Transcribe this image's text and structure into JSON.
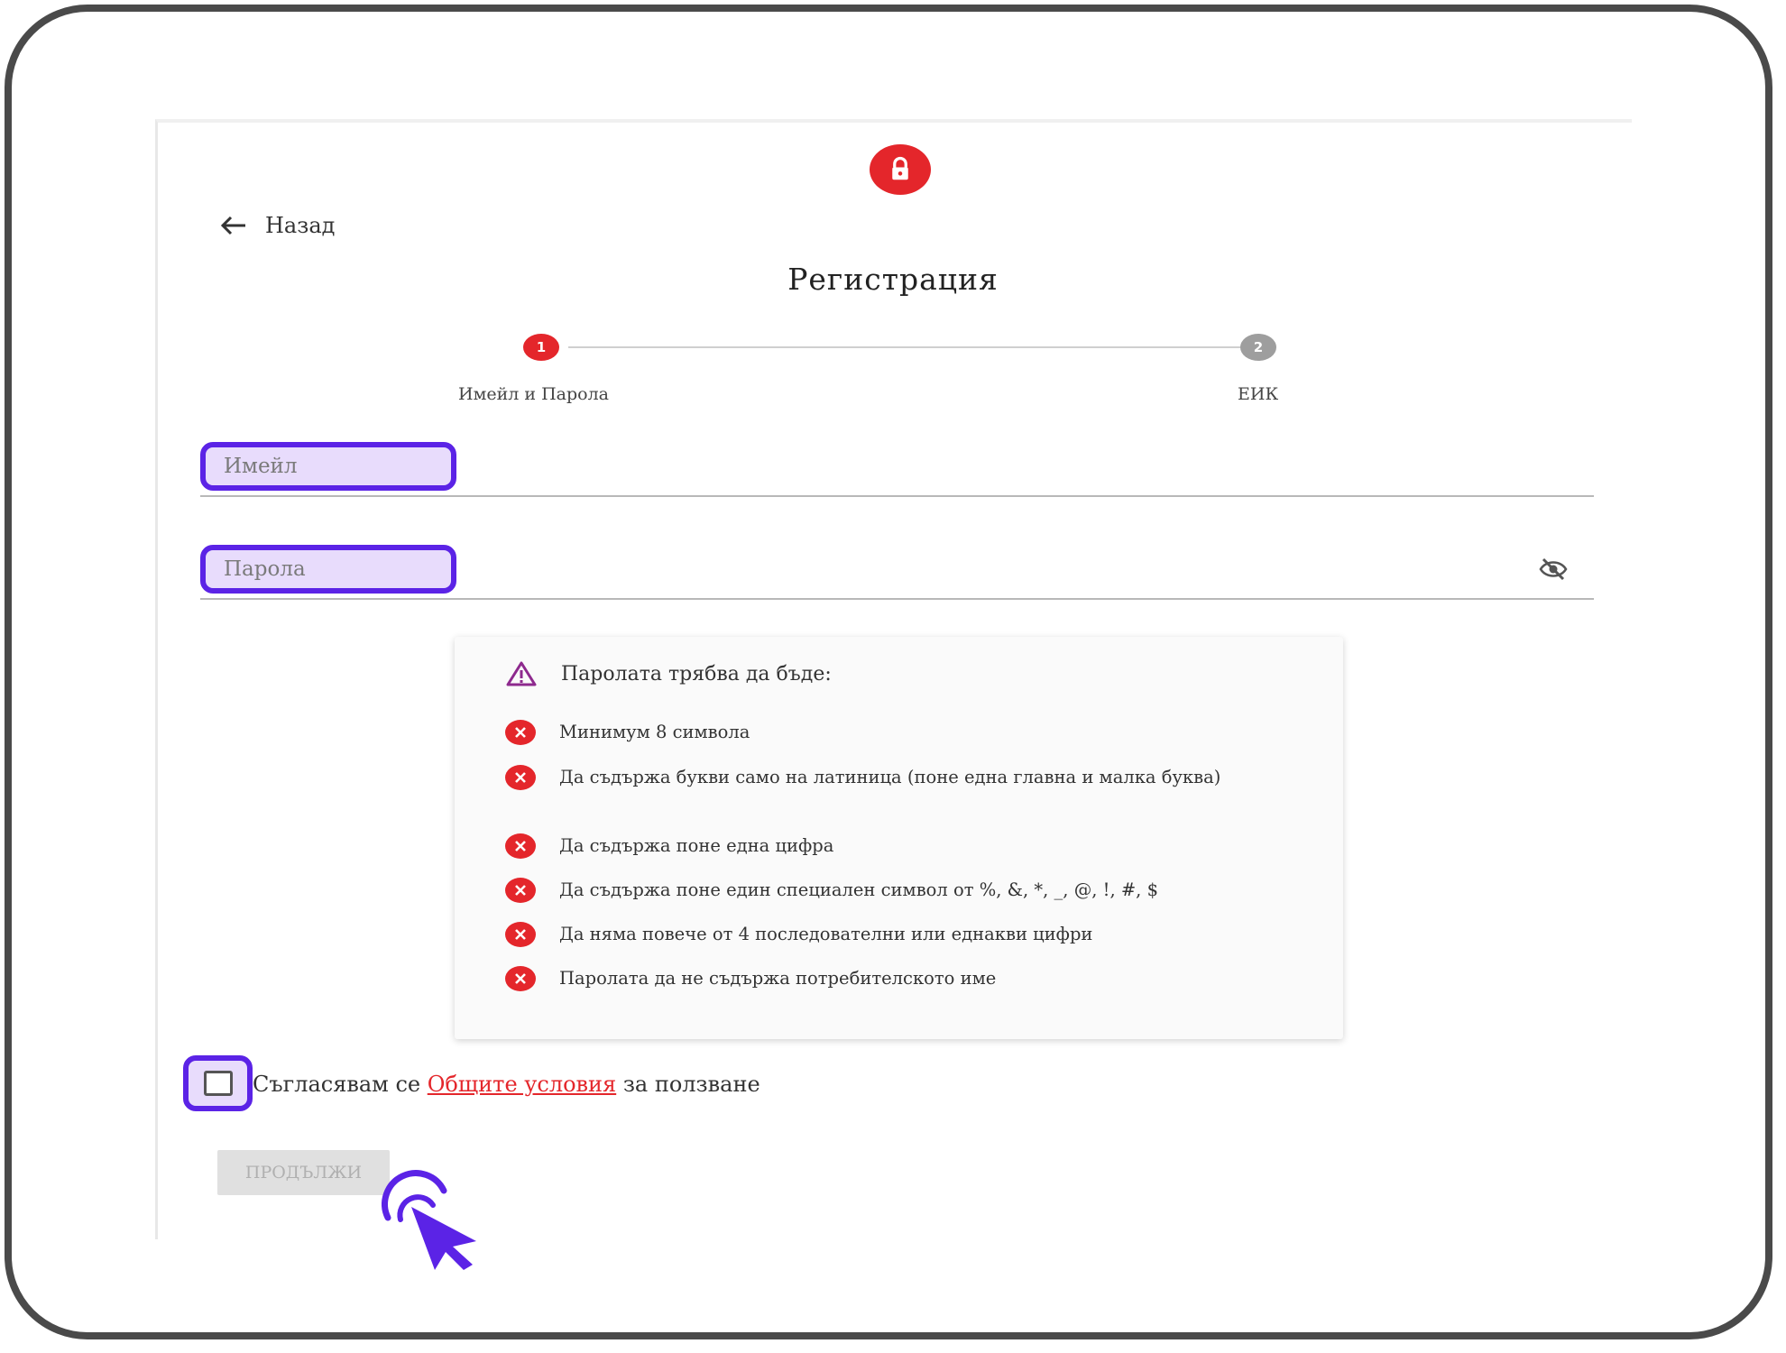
{
  "header": {
    "lock_icon": "lock-icon",
    "back_label": "Назад",
    "title": "Регистрация"
  },
  "stepper": {
    "steps": [
      {
        "number": "1",
        "label": "Имейл и Парола",
        "state": "active"
      },
      {
        "number": "2",
        "label": "ЕИК",
        "state": "inactive"
      }
    ]
  },
  "form": {
    "email_label": "Имейл",
    "password_label": "Парола"
  },
  "password_rules": {
    "heading": "Паролата трябва да бъде:",
    "items": [
      "Минимум 8 символа",
      "Да съдържа букви само на латиница (поне една главна и малка буква)",
      "Да съдържа поне една цифра",
      "Да съдържа поне един специален символ от %, &, *, _, @, !, #, $",
      "Да няма повече от 4 последователни или еднакви цифри",
      "Паролата да не съдържа потребителското име"
    ]
  },
  "agreement": {
    "prefix": "Съгласявам се ",
    "link": "Общите условия",
    "suffix": " за ползване"
  },
  "actions": {
    "continue_label": "ПРОДЪЛЖИ"
  },
  "colors": {
    "accent": "#e4262b",
    "highlight": "#5b23e6",
    "highlight_fill": "#e8dcfc",
    "warning_icon": "#8e2a8e"
  }
}
